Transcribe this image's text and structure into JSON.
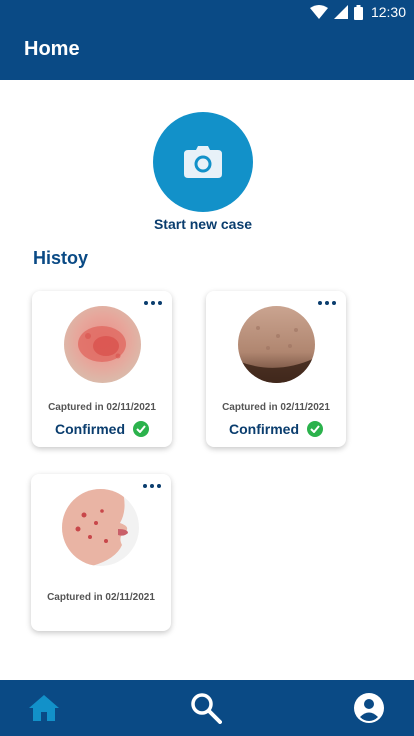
{
  "status_bar": {
    "time": "12:30",
    "icons": [
      "wifi-icon",
      "signal-icon",
      "battery-icon"
    ]
  },
  "app_bar": {
    "title": "Home"
  },
  "start_case": {
    "icon": "camera-icon",
    "label": "Start new case"
  },
  "history": {
    "title": "Histoy",
    "cases": [
      {
        "captured": "Captured in 02/11/2021",
        "status": "Confirmed",
        "image": "red-rash-skin"
      },
      {
        "captured": "Captured in 02/11/2021",
        "status": "Confirmed",
        "image": "textured-skin"
      },
      {
        "captured": "Captured in 02/11/2021",
        "status": "",
        "image": "acne-cheek"
      }
    ]
  },
  "bottom_nav": {
    "items": [
      "home-icon",
      "search-icon",
      "account-icon"
    ],
    "active": "home-icon"
  },
  "colors": {
    "primary": "#0a4a85",
    "accent": "#1291c9",
    "confirmed": "#2bb24c",
    "active_nav": "#1291c9"
  }
}
